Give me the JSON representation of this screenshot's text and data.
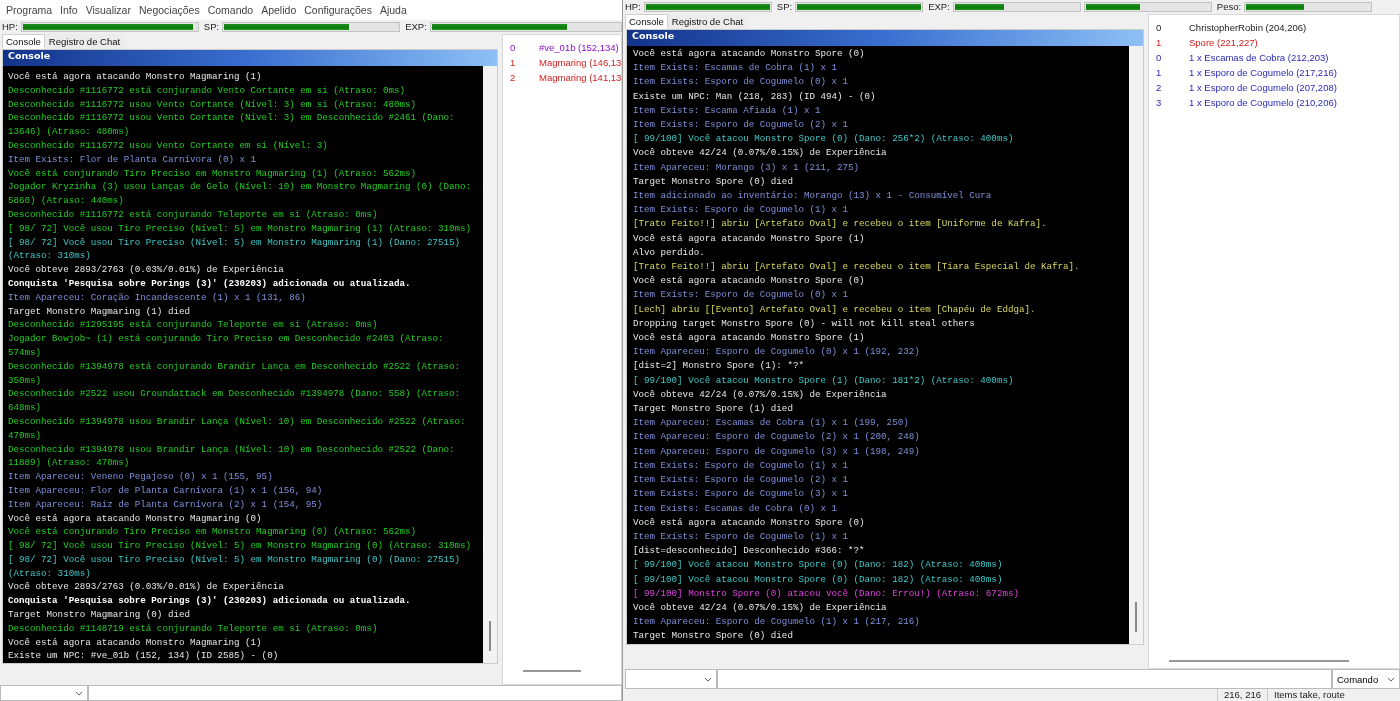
{
  "left_window": {
    "menu": [
      "Programa",
      "Info",
      "Visualizar",
      "Negociações",
      "Comando",
      "Apelido",
      "Configurações",
      "Ajuda"
    ],
    "stats": [
      {
        "label": "HP:",
        "bars": [
          {
            "level": 0.98
          }
        ]
      },
      {
        "label": "SP:",
        "bars": [
          {
            "level": 0.72
          }
        ]
      },
      {
        "label": "EXP:",
        "bars": [
          {
            "level": 0.72
          }
        ]
      }
    ],
    "tabs": [
      {
        "label": "Console",
        "selected": true
      },
      {
        "label": "Registro de Chat",
        "selected": false
      }
    ],
    "console": {
      "title": "Console",
      "lines": [
        {
          "text": "Você está agora atacando Monstro Magmaring (1)",
          "kind": "normal"
        },
        {
          "text": "Desconhecido #1116772 está conjurando Vento Cortante em si (Atraso: 0ms)",
          "kind": "skill"
        },
        {
          "text": "Desconhecido #1116772 usou Vento Cortante (Nível: 3) em si (Atraso: 480ms)",
          "kind": "skill"
        },
        {
          "text": "Desconhecido #1116772 usou Vento Cortante (Nível: 3) em Desconhecido #2461 (Dano: 13646) (Atraso: 480ms)",
          "kind": "skill"
        },
        {
          "text": "Desconhecido #1116772 usou Vento Cortante em si (Nível: 3)",
          "kind": "skill"
        },
        {
          "text": "Item Exists: Flor de Planta Carnívora (0) x 1",
          "kind": "item"
        },
        {
          "text": "Você está conjurando Tiro Preciso em Monstro Magmaring (1) (Atraso: 562ms)",
          "kind": "skill"
        },
        {
          "text": "Jogador Kryzinha (3) usou Lanças de Gelo (Nível: 10) em Monstro Magmaring (0) (Dano: 5860) (Atraso: 440ms)",
          "kind": "skill"
        },
        {
          "text": "Desconhecido #1116772 está conjurando Teleporte em si (Atraso: 0ms)",
          "kind": "skill"
        },
        {
          "text": "[ 98/ 72] Você usou Tiro Preciso (Nível: 5) em Monstro Magmaring (1) (Atraso: 310ms)",
          "kind": "skill"
        },
        {
          "text": "[ 98/ 72] Você usou Tiro Preciso (Nível: 5) em Monstro Magmaring (1) (Dano: 27515) (Atraso: 310ms)",
          "kind": "hit"
        },
        {
          "text": "Você obteve 2893/2763 (0.03%/0.01%) de Experiência",
          "kind": "normal"
        },
        {
          "text": "Conquista 'Pesquisa sobre Porings (3)' (230203) adicionada ou atualizada.",
          "kind": "notice"
        },
        {
          "text": "Item Apareceu: Coração Incandescente (1) x 1 (131, 86)",
          "kind": "item"
        },
        {
          "text": "Target Monstro Magmaring (1) died",
          "kind": "normal"
        },
        {
          "text": "Desconhecido #1295195 está conjurando Teleporte em si (Atraso: 0ms)",
          "kind": "skill"
        },
        {
          "text": "Jogador Bowjob~ (1) está conjurando Tiro Preciso em Desconhecido #2403 (Atraso: 574ms)",
          "kind": "skill"
        },
        {
          "text": "Desconhecido #1394978 está conjurando Brandir Lança em Desconhecido #2522 (Atraso: 350ms)",
          "kind": "skill"
        },
        {
          "text": "Desconhecido #2522 usou Groundattack em Desconhecido #1394978 (Dano: 558) (Atraso: 648ms)",
          "kind": "skill"
        },
        {
          "text": "Desconhecido #1394978 usou Brandir Lança (Nível: 10) em Desconhecido #2522 (Atraso: 470ms)",
          "kind": "skill"
        },
        {
          "text": "Desconhecido #1394978 usou Brandir Lança (Nível: 10) em Desconhecido #2522 (Dano: 11889) (Atraso: 470ms)",
          "kind": "skill"
        },
        {
          "text": "Item Apareceu: Veneno Pegajoso (0) x 1 (155, 95)",
          "kind": "item"
        },
        {
          "text": "Item Apareceu: Flor de Planta Carnívora (1) x 1 (156, 94)",
          "kind": "item"
        },
        {
          "text": "Item Apareceu: Raiz de Planta Carnívora (2) x 1 (154, 95)",
          "kind": "item"
        },
        {
          "text": "Você está agora atacando Monstro Magmaring (0)",
          "kind": "normal"
        },
        {
          "text": "Você está conjurando Tiro Preciso em Monstro Magmaring (0) (Atraso: 562ms)",
          "kind": "skill"
        },
        {
          "text": "[ 98/ 72] Você usou Tiro Preciso (Nível: 5) em Monstro Magmaring (0) (Atraso: 310ms)",
          "kind": "skill"
        },
        {
          "text": "[ 98/ 72] Você usou Tiro Preciso (Nível: 5) em Monstro Magmaring (0) (Dano: 27515) (Atraso: 310ms)",
          "kind": "hit"
        },
        {
          "text": "Você obteve 2893/2763 (0.03%/0.01%) de Experiência",
          "kind": "normal"
        },
        {
          "text": "Conquista 'Pesquisa sobre Porings (3)' (230203) adicionada ou atualizada.",
          "kind": "notice"
        },
        {
          "text": "Target Monstro Magmaring (0) died",
          "kind": "normal"
        },
        {
          "text": "Desconhecido #1148719 está conjurando Teleporte em si (Atraso: 0ms)",
          "kind": "skill"
        },
        {
          "text": "Você está agora atacando Monstro Magmaring (1)",
          "kind": "normal"
        },
        {
          "text": "Existe um NPC: #ve_01b (152, 134) (ID 2585) - (0)",
          "kind": "normal"
        }
      ]
    },
    "list": [
      {
        "index": "0",
        "text": "#ve_01b (152,134)",
        "kind": "npc"
      },
      {
        "index": "1",
        "text": "Magmaring (146,13",
        "kind": "monster"
      },
      {
        "index": "2",
        "text": "Magmaring (141,13",
        "kind": "monster"
      }
    ]
  },
  "right_window": {
    "stats": [
      {
        "label": "HP:",
        "bars": [
          {
            "level": 1
          }
        ]
      },
      {
        "label": "SP:",
        "bars": [
          {
            "level": 1
          }
        ]
      },
      {
        "label": "EXP:",
        "bars": [
          {
            "level": 0.4
          },
          {
            "level": 0.44
          }
        ]
      },
      {
        "label": "Peso:",
        "bars": [
          {
            "level": 0.47
          }
        ]
      }
    ],
    "tabs": [
      {
        "label": "Console",
        "selected": true
      },
      {
        "label": "Registro de Chat",
        "selected": false
      }
    ],
    "console": {
      "title": "Console",
      "lines": [
        {
          "text": "Você está agora atacando Monstro Spore (0)",
          "kind": "normal"
        },
        {
          "text": "Item Exists: Escamas de Cobra (1) x 1",
          "kind": "item"
        },
        {
          "text": "Item Exists: Esporo de Cogumelo (0) x 1",
          "kind": "item"
        },
        {
          "text": "Existe um NPC: Man (218, 283) (ID 494) - (0)",
          "kind": "normal"
        },
        {
          "text": "Item Exists: Escama Afiada (1) x 1",
          "kind": "item"
        },
        {
          "text": "Item Exists: Esporo de Cogumelo (2) x 1",
          "kind": "item"
        },
        {
          "text": "[ 99/100] Você atacou Monstro Spore (0) (Dano: 256*2) (Atraso: 400ms)",
          "kind": "hit"
        },
        {
          "text": "Você obteve 42/24 (0.07%/0.15%) de Experiência",
          "kind": "normal"
        },
        {
          "text": "Item Apareceu: Morango (3) x 1 (211, 275)",
          "kind": "item"
        },
        {
          "text": "Target Monstro Spore (0) died",
          "kind": "normal"
        },
        {
          "text": "Item adicionado ao inventário: Morango (13) x 1 - Consumível Cura",
          "kind": "item"
        },
        {
          "text": "Item Exists: Esporo de Cogumelo (1) x 1",
          "kind": "item"
        },
        {
          "text": "[Trato Feito!!] abriu [Artefato Oval] e recebeu o item [Uniforme de Kafra].",
          "kind": "deal"
        },
        {
          "text": "Você está agora atacando Monstro Spore (1)",
          "kind": "normal"
        },
        {
          "text": "Alvo perdido.",
          "kind": "normal"
        },
        {
          "text": "[Trato Feito!!] abriu [Artefato Oval] e recebeu o item [Tiara Especial de Kafra].",
          "kind": "deal"
        },
        {
          "text": "Você está agora atacando Monstro Spore (0)",
          "kind": "normal"
        },
        {
          "text": "Item Exists: Esporo de Cogumelo (0) x 1",
          "kind": "item"
        },
        {
          "text": "[Lech] abriu [[Evento] Artefato Oval] e recebeu o item [Chapéu de Eddga].",
          "kind": "deal"
        },
        {
          "text": "Dropping target Monstro Spore (0) - will not kill steal others",
          "kind": "normal"
        },
        {
          "text": "Você está agora atacando Monstro Spore (1)",
          "kind": "normal"
        },
        {
          "text": "Item Apareceu: Esporo de Cogumelo (0) x 1 (192, 232)",
          "kind": "item"
        },
        {
          "text": "[dist=2] Monstro Spore (1): *?*",
          "kind": "normal"
        },
        {
          "text": "[ 99/100] Você atacou Monstro Spore (1) (Dano: 181*2) (Atraso: 400ms)",
          "kind": "hit"
        },
        {
          "text": "Você obteve 42/24 (0.07%/0.15%) de Experiência",
          "kind": "normal"
        },
        {
          "text": "Target Monstro Spore (1) died",
          "kind": "normal"
        },
        {
          "text": "Item Apareceu: Escamas de Cobra (1) x 1 (199, 250)",
          "kind": "item"
        },
        {
          "text": "Item Apareceu: Esporo de Cogumelo (2) x 1 (200, 248)",
          "kind": "item"
        },
        {
          "text": "Item Apareceu: Esporo de Cogumelo (3) x 1 (198, 249)",
          "kind": "item"
        },
        {
          "text": "Item Exists: Esporo de Cogumelo (1) x 1",
          "kind": "item"
        },
        {
          "text": "Item Exists: Esporo de Cogumelo (2) x 1",
          "kind": "item"
        },
        {
          "text": "Item Exists: Esporo de Cogumelo (3) x 1",
          "kind": "item"
        },
        {
          "text": "Item Exists: Escamas de Cobra (0) x 1",
          "kind": "item"
        },
        {
          "text": "Você está agora atacando Monstro Spore (0)",
          "kind": "normal"
        },
        {
          "text": "Item Exists: Esporo de Cogumelo (1) x 1",
          "kind": "item"
        },
        {
          "text": "[dist=desconhecido] Desconhecido #366: *?*",
          "kind": "normal"
        },
        {
          "text": "[ 99/100] Você atacou Monstro Spore (0) (Dano: 182) (Atraso: 400ms)",
          "kind": "hit"
        },
        {
          "text": "[ 99/100] Você atacou Monstro Spore (0) (Dano: 182) (Atraso: 400ms)",
          "kind": "hit"
        },
        {
          "text": "[ 99/100] Monstro Spore (0) atacou você (Dano: Errou!) (Atraso: 672ms)",
          "kind": "miss"
        },
        {
          "text": "Você obteve 42/24 (0.07%/0.15%) de Experiência",
          "kind": "normal"
        },
        {
          "text": "Item Apareceu: Esporo de Cogumelo (1) x 1 (217, 216)",
          "kind": "item"
        },
        {
          "text": "Target Monstro Spore (0) died",
          "kind": "normal"
        }
      ]
    },
    "list": [
      {
        "index": "0",
        "text": "ChristopherRobin (204,206)",
        "kind": "player"
      },
      {
        "index": "1",
        "text": "Spore (221,227)",
        "kind": "monster"
      },
      {
        "index": "0",
        "text": "1 x Escamas de Cobra (212,203)",
        "kind": "item"
      },
      {
        "index": "1",
        "text": "1 x Esporo de Cogumelo (217,216)",
        "kind": "item"
      },
      {
        "index": "2",
        "text": "1 x Esporo de Cogumelo (207,208)",
        "kind": "item"
      },
      {
        "index": "3",
        "text": "1 x Esporo de Cogumelo (210,206)",
        "kind": "item"
      }
    ],
    "command_mode": "Comando",
    "status_bar": [
      "216, 216",
      "Items take, route"
    ]
  }
}
